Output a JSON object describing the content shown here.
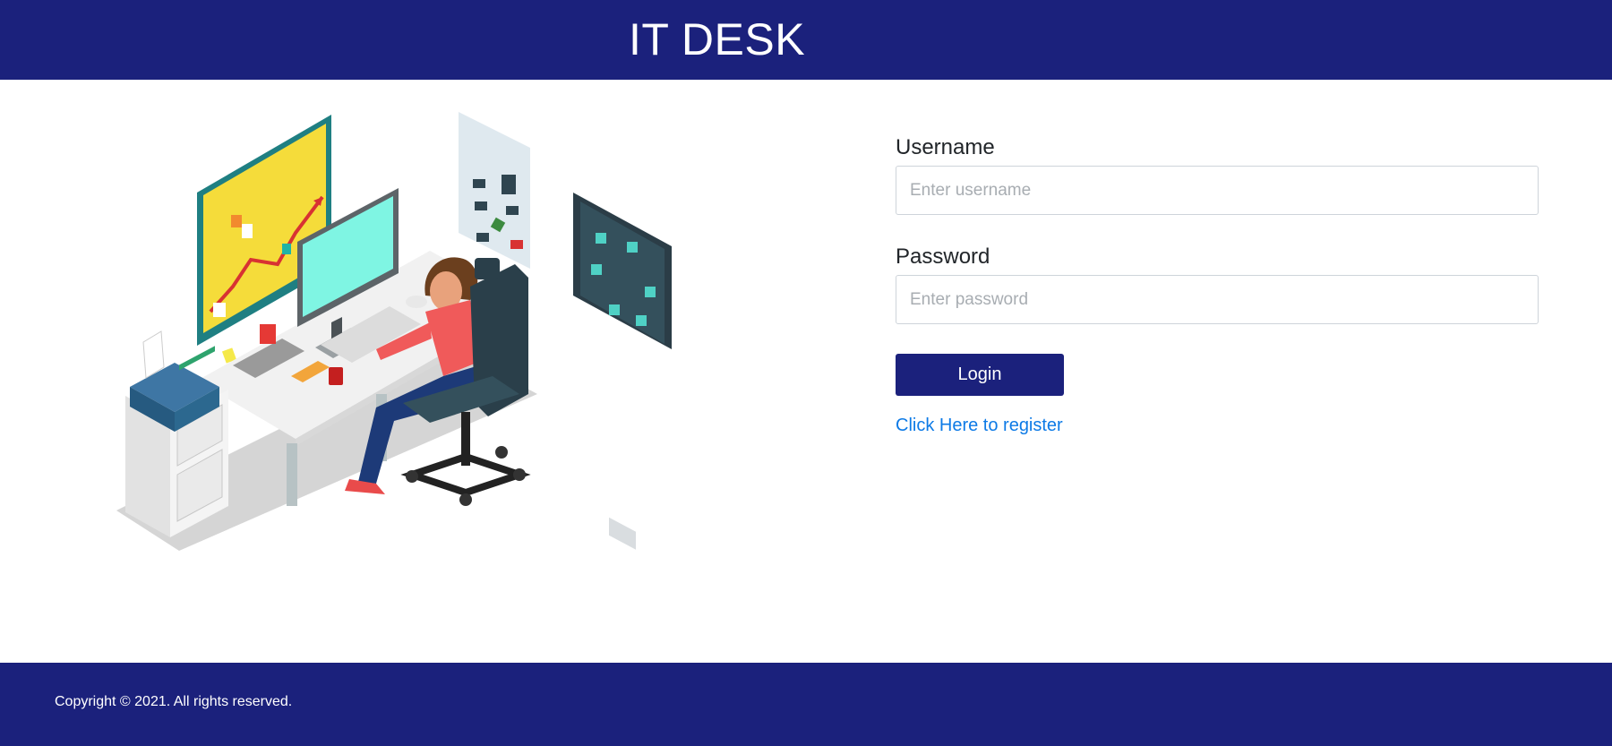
{
  "header": {
    "title": "IT DESK"
  },
  "form": {
    "username": {
      "label": "Username",
      "placeholder": "Enter username",
      "value": ""
    },
    "password": {
      "label": "Password",
      "placeholder": "Enter password",
      "value": ""
    },
    "login_label": "Login",
    "register_link": "Click Here to register"
  },
  "footer": {
    "copyright": "Copyright © 2021. All rights reserved."
  },
  "colors": {
    "brand": "#1b217c",
    "link": "#0d7ae6",
    "input_border": "#ced4da"
  },
  "illustration": {
    "name": "it-desk-workstation-illustration"
  }
}
